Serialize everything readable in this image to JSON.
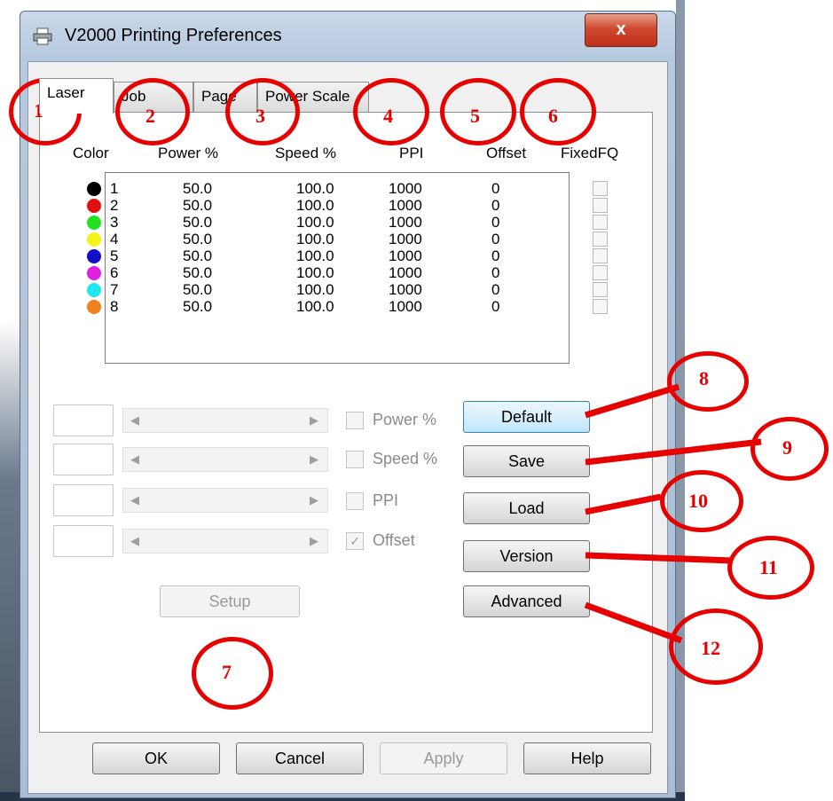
{
  "window": {
    "title": "V2000 Printing Preferences",
    "close_glyph": "x"
  },
  "tabs": [
    {
      "label": "Laser",
      "active": true
    },
    {
      "label": "Job"
    },
    {
      "label": "Page"
    },
    {
      "label": "Power Scale"
    }
  ],
  "table": {
    "headers": [
      "Color",
      "Power %",
      "Speed %",
      "PPI",
      "Offset",
      "FixedFQ"
    ],
    "rows": [
      {
        "num": "1",
        "color": "#000000",
        "power": "50.0",
        "speed": "100.0",
        "ppi": "1000",
        "offset": "0"
      },
      {
        "num": "2",
        "color": "#e01010",
        "power": "50.0",
        "speed": "100.0",
        "ppi": "1000",
        "offset": "0"
      },
      {
        "num": "3",
        "color": "#22e022",
        "power": "50.0",
        "speed": "100.0",
        "ppi": "1000",
        "offset": "0"
      },
      {
        "num": "4",
        "color": "#f4f41a",
        "power": "50.0",
        "speed": "100.0",
        "ppi": "1000",
        "offset": "0"
      },
      {
        "num": "5",
        "color": "#1010c8",
        "power": "50.0",
        "speed": "100.0",
        "ppi": "1000",
        "offset": "0"
      },
      {
        "num": "6",
        "color": "#e020e0",
        "power": "50.0",
        "speed": "100.0",
        "ppi": "1000",
        "offset": "0"
      },
      {
        "num": "7",
        "color": "#22e6ee",
        "power": "50.0",
        "speed": "100.0",
        "ppi": "1000",
        "offset": "0"
      },
      {
        "num": "8",
        "color": "#f08020",
        "power": "50.0",
        "speed": "100.0",
        "ppi": "1000",
        "offset": "0"
      }
    ]
  },
  "controls": {
    "power_label": "Power %",
    "speed_label": "Speed %",
    "ppi_label": "PPI",
    "offset_label": "Offset",
    "offset_checked": true,
    "setup": "Setup"
  },
  "side_buttons": {
    "default": "Default",
    "save": "Save",
    "load": "Load",
    "version": "Version",
    "advanced": "Advanced"
  },
  "footer": {
    "ok": "OK",
    "cancel": "Cancel",
    "apply": "Apply",
    "help": "Help"
  },
  "annotations": [
    "1",
    "2",
    "3",
    "4",
    "5",
    "6",
    "7",
    "8",
    "9",
    "10",
    "11",
    "12"
  ],
  "annotation_color": "#e60000"
}
